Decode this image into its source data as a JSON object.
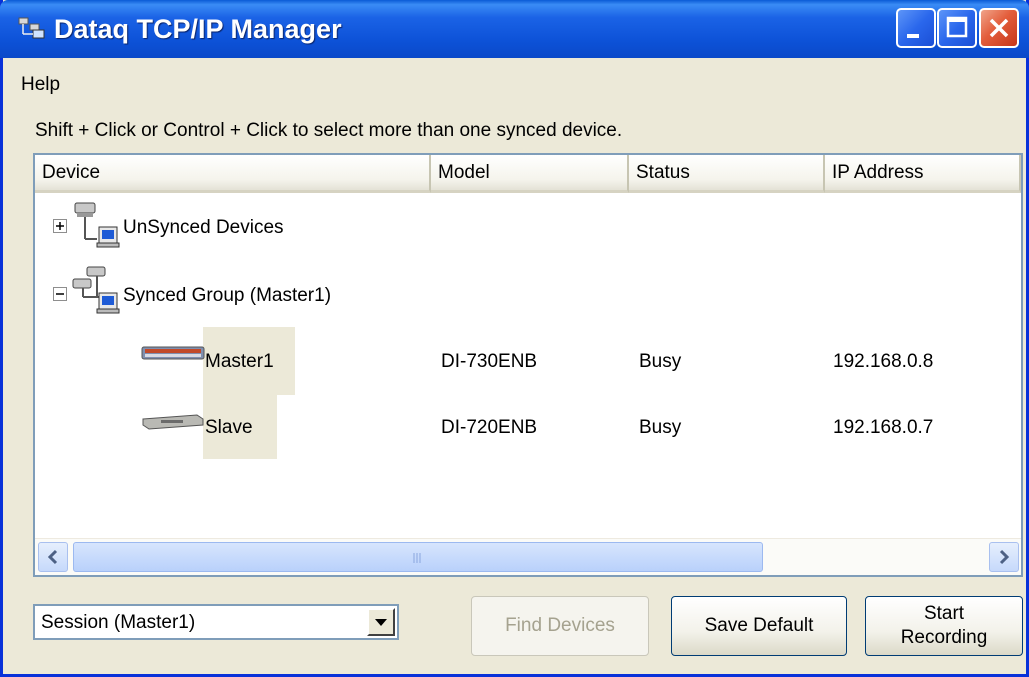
{
  "window": {
    "title": "Dataq TCP/IP Manager"
  },
  "menu": {
    "help": "Help"
  },
  "hint": "Shift + Click or Control + Click to select more than one synced device.",
  "table": {
    "columns": [
      "Device",
      "Model",
      "Status",
      "IP Address"
    ],
    "groups": [
      {
        "label": "UnSynced Devices",
        "expanded": false,
        "expander": "+"
      },
      {
        "label": "Synced Group (Master1)",
        "expanded": true,
        "expander": "−"
      }
    ],
    "devices": [
      {
        "name": "Master1",
        "model": "DI-730ENB",
        "status": "Busy",
        "ip": "192.168.0.8",
        "icon": "di730-device-icon"
      },
      {
        "name": "Slave",
        "model": "DI-720ENB",
        "status": "Busy",
        "ip": "192.168.0.7",
        "icon": "di720-device-icon"
      }
    ]
  },
  "session_select": {
    "value": "Session (Master1)"
  },
  "buttons": {
    "find_devices": "Find Devices",
    "save_default": "Save Default",
    "start_recording_line1": "Start",
    "start_recording_line2": "Recording"
  },
  "colors": {
    "titlebar": "#0a49c9",
    "window_bg": "#ece9d8",
    "close_button": "#c6361a"
  }
}
